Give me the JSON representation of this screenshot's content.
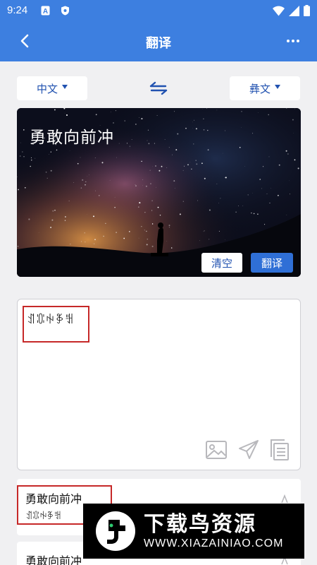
{
  "status_bar": {
    "time": "9:24",
    "icons": [
      "a-badge-icon",
      "shield-icon",
      "wifi-icon",
      "signal-icon",
      "battery-icon"
    ]
  },
  "app_bar": {
    "title": "翻译",
    "back_icon": "chevron-left-icon",
    "more_icon": "more-horizontal-icon"
  },
  "lang": {
    "source": "中文",
    "target": "彝文",
    "swap_icon": "swap-arrows-icon"
  },
  "input": {
    "text": "勇敢向前冲",
    "clear_label": "清空",
    "translate_label": "翻译"
  },
  "result": {
    "text": "ꀊꁤꑭꃆꅿ",
    "image_icon": "image-icon",
    "send_icon": "send-icon",
    "copy_icon": "copy-icon"
  },
  "history": [
    {
      "source": "勇敢向前冲",
      "target": "ꀊꁤꑭꃆꅿ"
    },
    {
      "source": "勇敢向前冲",
      "target": ""
    }
  ],
  "watermark": {
    "brand": "下载鸟资源",
    "url": "WWW.XIAZAINIAO.COM"
  },
  "colors": {
    "primary": "#3d7fe0",
    "accent_text": "#2152b0",
    "highlight_box": "#c62828",
    "page_bg": "#f0f0f2"
  }
}
